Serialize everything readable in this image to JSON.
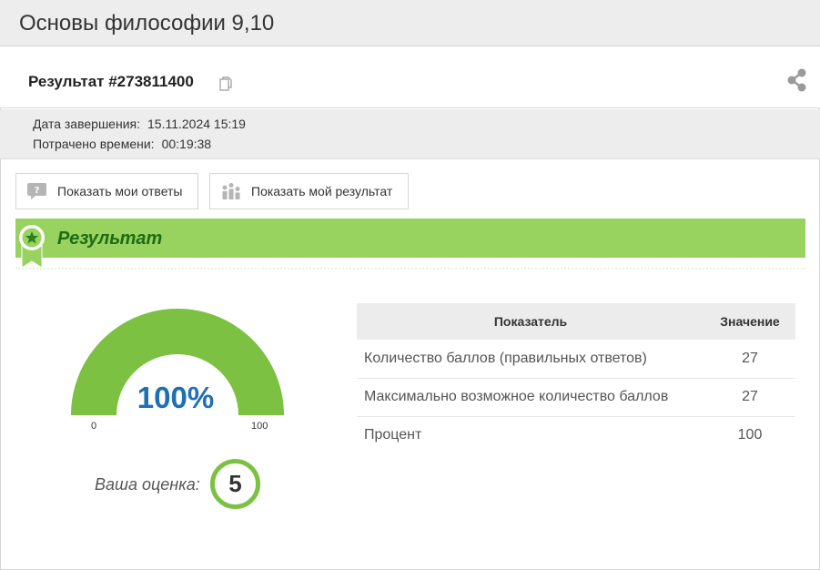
{
  "page": {
    "title": "Основы философии 9,10"
  },
  "result": {
    "title": "Результат #273811400",
    "copy_icon": "copy-icon",
    "share_icon": "share-icon"
  },
  "meta": {
    "finish_label": "Дата завершения:",
    "finish_value": "15.11.2024 15:19",
    "time_label": "Потрачено времени:",
    "time_value": "00:19:38"
  },
  "buttons": {
    "show_answers": "Показать мои ответы",
    "show_result": "Показать мой результат"
  },
  "section": {
    "title": "Результат"
  },
  "gauge": {
    "value_label": "100%",
    "value": 100,
    "min_label": "0",
    "max_label": "100",
    "min": 0,
    "max": 100,
    "color": "#7cc142",
    "text_color": "#1e6fb6"
  },
  "grade": {
    "label": "Ваша оценка:",
    "value": "5"
  },
  "table": {
    "headers": [
      "Показатель",
      "Значение"
    ],
    "rows": [
      [
        "Количество баллов (правильных ответов)",
        "27"
      ],
      [
        "Максимально возможное количество баллов",
        "27"
      ],
      [
        "Процент",
        "100"
      ]
    ]
  },
  "colors": {
    "accent_green": "#97d35e",
    "dark_green": "#1f6b17",
    "header_gray": "#ededed"
  }
}
